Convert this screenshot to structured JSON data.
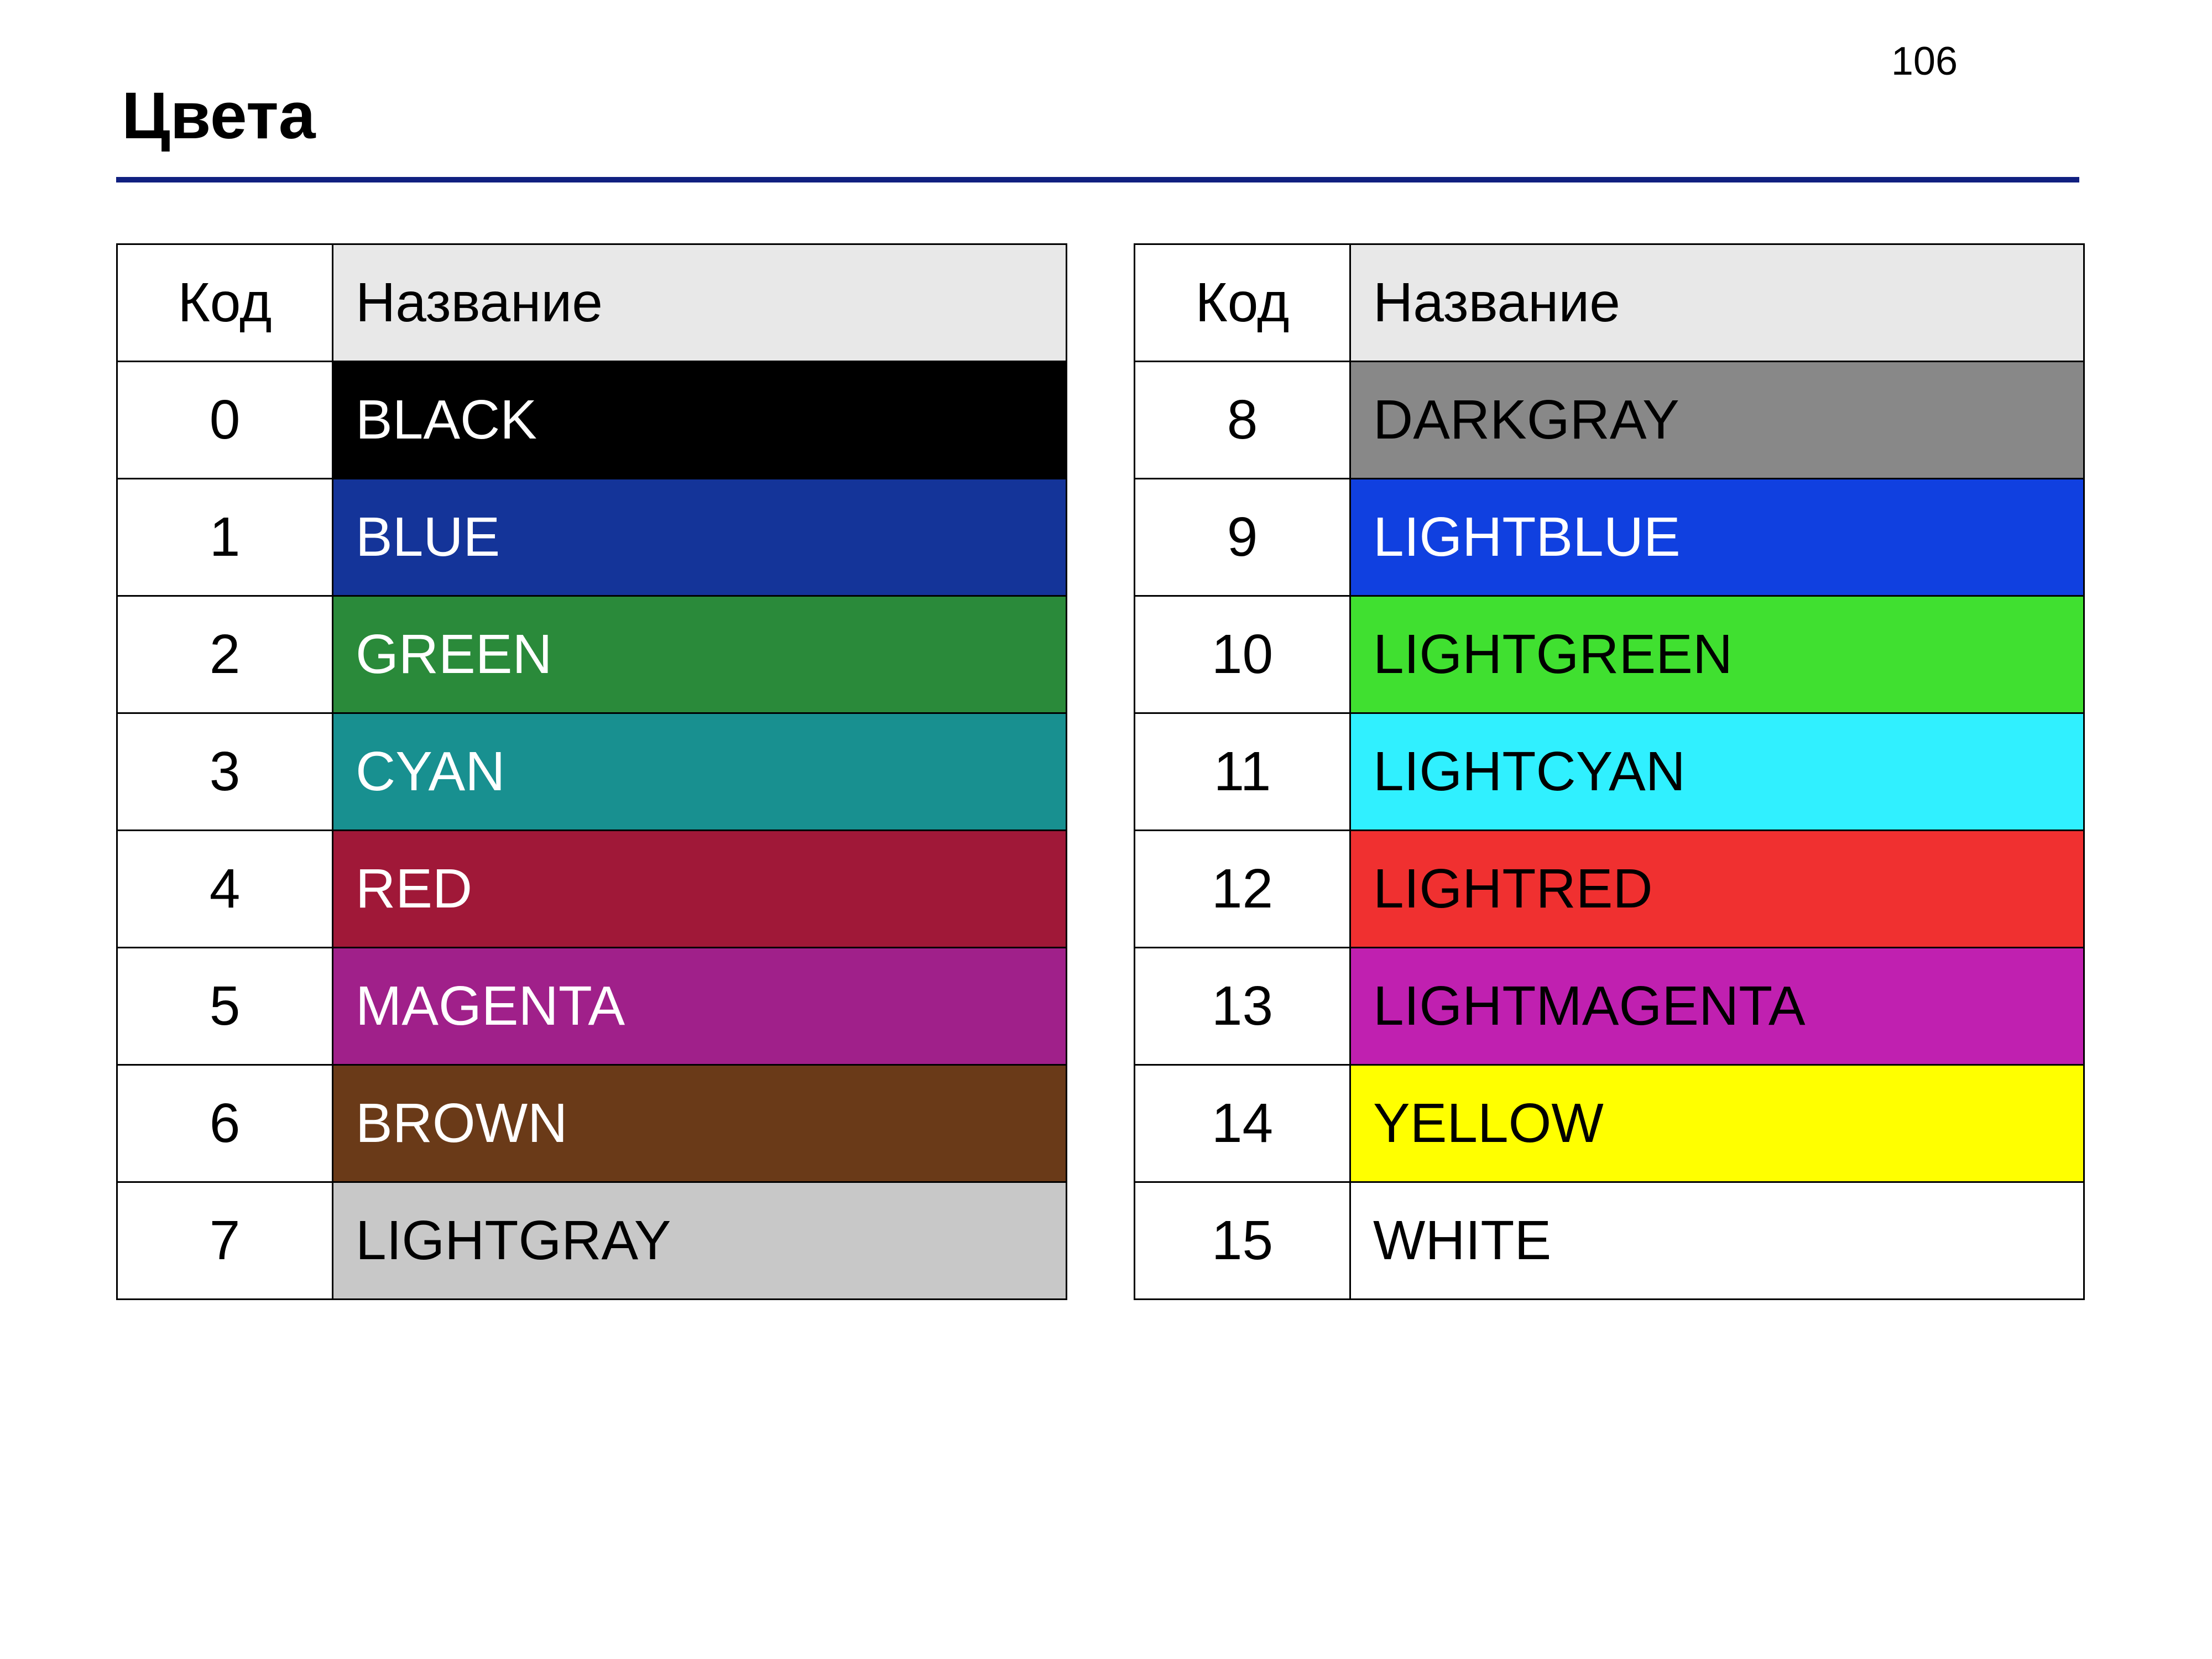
{
  "page_number": "106",
  "title": "Цвета",
  "headers": {
    "code": "Код",
    "name": "Название"
  },
  "left_table": [
    {
      "code": "0",
      "name": "BLACK",
      "bg": "#000000",
      "fg": "#ffffff"
    },
    {
      "code": "1",
      "name": "BLUE",
      "bg": "#143499",
      "fg": "#ffffff"
    },
    {
      "code": "2",
      "name": "GREEN",
      "bg": "#2a8a3a",
      "fg": "#ffffff"
    },
    {
      "code": "3",
      "name": "CYAN",
      "bg": "#189090",
      "fg": "#ffffff"
    },
    {
      "code": "4",
      "name": "RED",
      "bg": "#a01838",
      "fg": "#ffffff"
    },
    {
      "code": "5",
      "name": "MAGENTA",
      "bg": "#a0208a",
      "fg": "#ffffff"
    },
    {
      "code": "6",
      "name": "BROWN",
      "bg": "#6a3a18",
      "fg": "#ffffff"
    },
    {
      "code": "7",
      "name": "LIGHTGRAY",
      "bg": "#c8c8c8",
      "fg": "#000000"
    }
  ],
  "right_table": [
    {
      "code": "8",
      "name": "DARKGRAY",
      "bg": "#888888",
      "fg": "#000000"
    },
    {
      "code": "9",
      "name": "LIGHTBLUE",
      "bg": "#1040e0",
      "fg": "#ffffff"
    },
    {
      "code": "10",
      "name": "LIGHTGREEN",
      "bg": "#40e030",
      "fg": "#000000"
    },
    {
      "code": "11",
      "name": "LIGHTCYAN",
      "bg": "#30f0ff",
      "fg": "#000000"
    },
    {
      "code": "12",
      "name": "LIGHTRED",
      "bg": "#f03030",
      "fg": "#000000"
    },
    {
      "code": "13",
      "name": "LIGHTMAGENTA",
      "bg": "#c020b0",
      "fg": "#000000"
    },
    {
      "code": "14",
      "name": "YELLOW",
      "bg": "#ffff00",
      "fg": "#000000"
    },
    {
      "code": "15",
      "name": "WHITE",
      "bg": "#ffffff",
      "fg": "#000000"
    }
  ]
}
